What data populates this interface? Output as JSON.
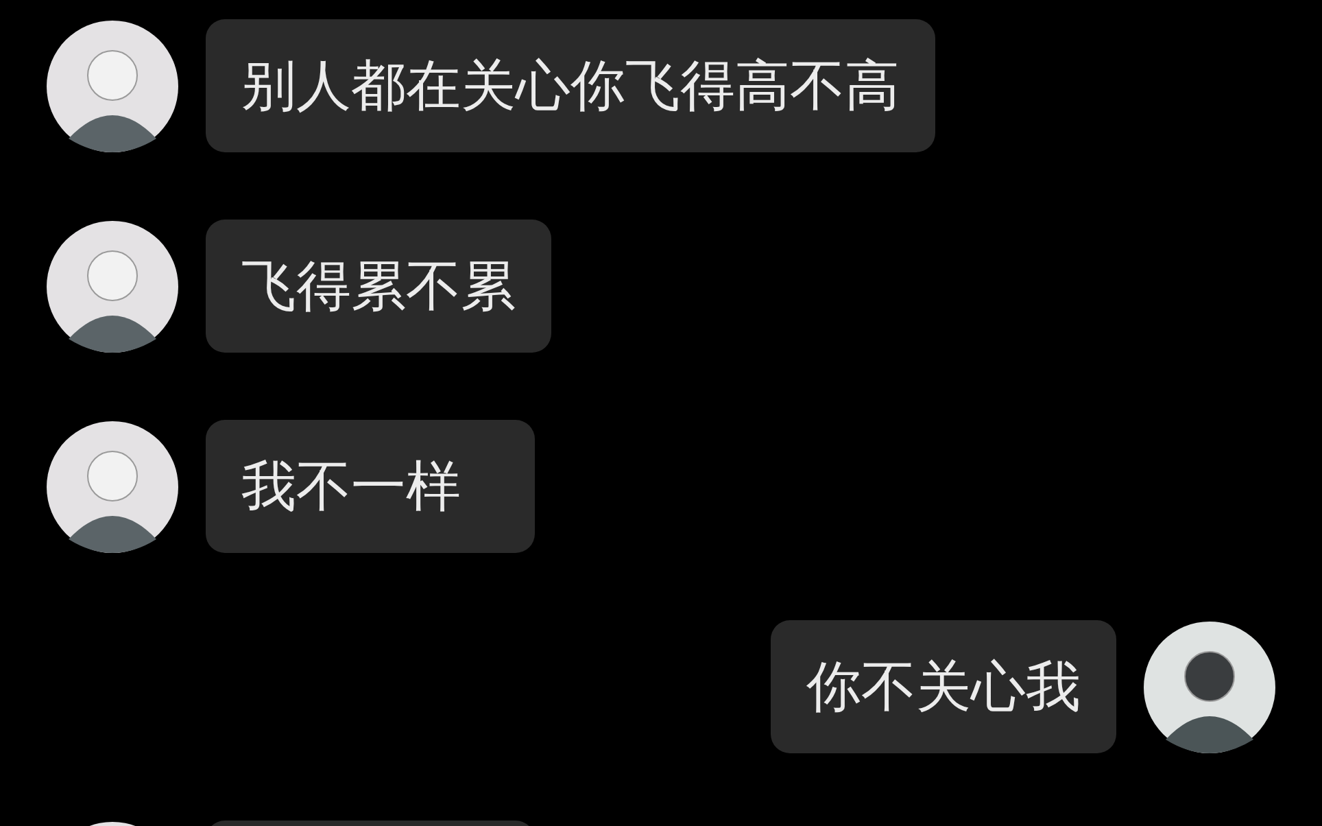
{
  "messages": [
    {
      "kind": "received",
      "text": "别人都在关心你飞得高不高"
    },
    {
      "kind": "received",
      "text": "飞得累不累"
    },
    {
      "kind": "received",
      "text": "我不一样"
    },
    {
      "kind": "sent",
      "text": "你不关心我"
    },
    {
      "kind": "received"
    }
  ]
}
